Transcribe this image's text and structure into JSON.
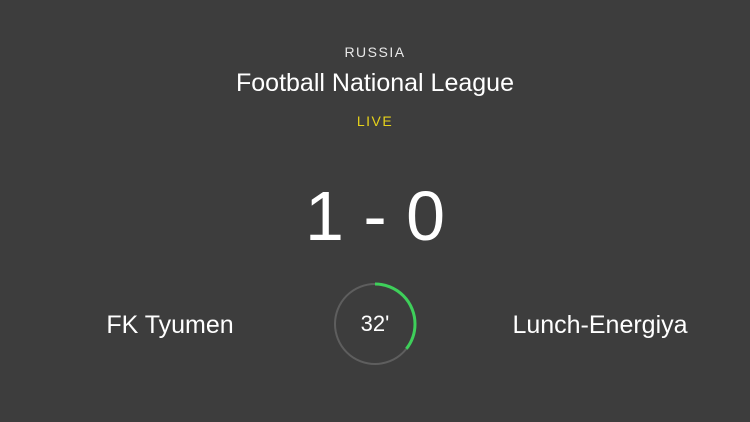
{
  "match": {
    "country": "RUSSIA",
    "league": "Football National League",
    "status": "LIVE",
    "score": "1 - 0",
    "home_team": "FK Tyumen",
    "away_team": "Lunch-Energiya",
    "minute_label": "32'",
    "minute_progress": 0.356
  },
  "colors": {
    "background": "#3d3d3d",
    "live": "#e6d21a",
    "progress": "#3ecf5a",
    "track": "#5e5e5e"
  }
}
